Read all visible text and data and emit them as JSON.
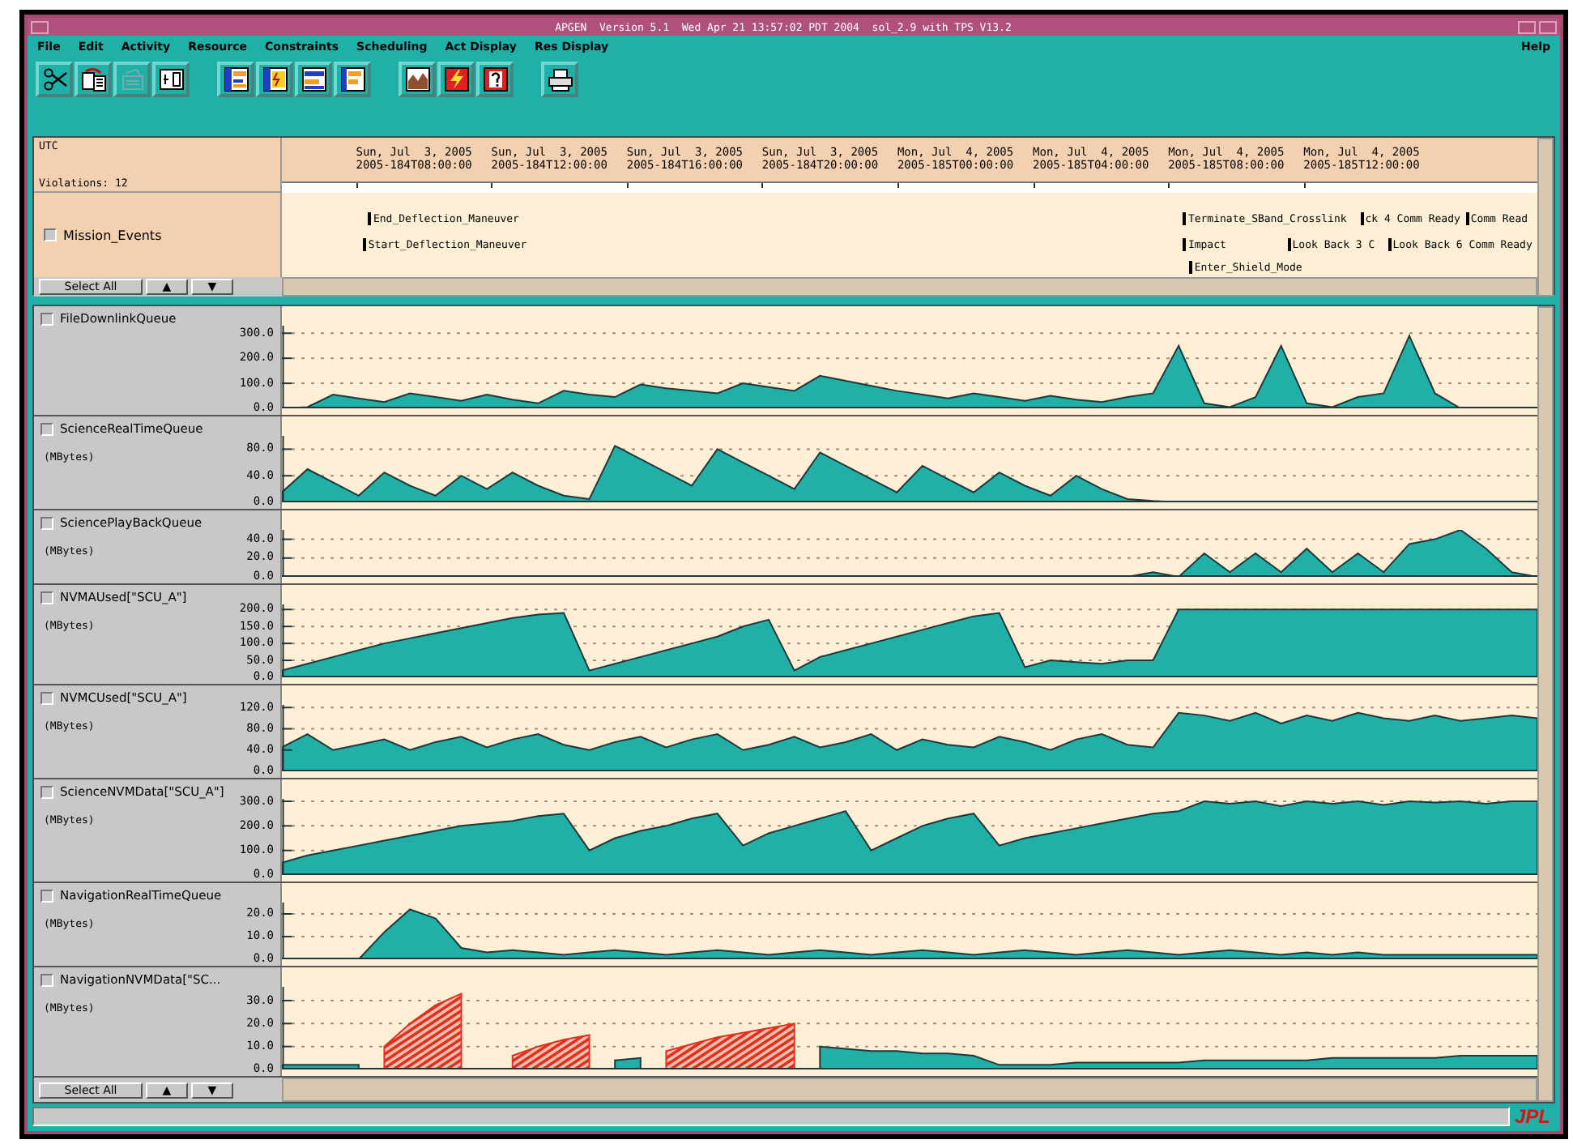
{
  "window": {
    "title": "APGEN  Version 5.1  Wed Apr 21 13:57:02 PDT 2004  sol_2.9 with TPS V13.2"
  },
  "menu": {
    "items": [
      "File",
      "Edit",
      "Activity",
      "Resource",
      "Constraints",
      "Scheduling",
      "Act Display",
      "Res Display"
    ],
    "help": "Help"
  },
  "timeline": {
    "zone": "UTC",
    "violations": "Violations: 12",
    "ticks": [
      {
        "date": "Sun, Jul  3, 2005",
        "stamp": "2005-184T08:00:00"
      },
      {
        "date": "Sun, Jul  3, 2005",
        "stamp": "2005-184T12:00:00"
      },
      {
        "date": "Sun, Jul  3, 2005",
        "stamp": "2005-184T16:00:00"
      },
      {
        "date": "Sun, Jul  3, 2005",
        "stamp": "2005-184T20:00:00"
      },
      {
        "date": "Mon, Jul  4, 2005",
        "stamp": "2005-185T00:00:00"
      },
      {
        "date": "Mon, Jul  4, 2005",
        "stamp": "2005-185T04:00:00"
      },
      {
        "date": "Mon, Jul  4, 2005",
        "stamp": "2005-185T08:00:00"
      },
      {
        "date": "Mon, Jul  4, 2005",
        "stamp": "2005-185T12:00:00"
      }
    ]
  },
  "activity_panel": {
    "legend": {
      "label": "Mission_Events",
      "checked": false
    },
    "lanes": [
      [
        "End_Deflection_Maneuver",
        "Terminate_SBand_Crosslink",
        "ck 4 Comm Ready",
        "Comm Read"
      ],
      [
        "Start_Deflection_Maneuver",
        "Impact",
        "Look Back 3 C",
        "Look Back 6 Comm Ready"
      ],
      [
        "Enter_Shield_Mode"
      ]
    ],
    "buttons": [
      "Select All",
      "▲",
      "▼"
    ]
  },
  "resources": [
    {
      "name": "FileDownlinkQueue",
      "checked": false,
      "chart_data": {
        "type": "area",
        "grid": true,
        "ylim": [
          0,
          330
        ],
        "yticks": [
          {
            "value": 0,
            "label": "0.0"
          },
          {
            "value": 100,
            "label": "100.0"
          },
          {
            "value": 200,
            "label": "200.0"
          },
          {
            "value": 300,
            "label": "300.0"
          }
        ],
        "series": [
          {
            "color": "#20b0a8",
            "values": [
              0,
              5,
              55,
              40,
              25,
              60,
              45,
              30,
              55,
              35,
              20,
              70,
              55,
              45,
              95,
              80,
              70,
              60,
              100,
              85,
              70,
              130,
              110,
              90,
              70,
              55,
              40,
              60,
              45,
              30,
              50,
              35,
              25,
              45,
              60,
              250,
              20,
              5,
              45,
              250,
              20,
              5,
              45,
              60,
              290,
              60,
              0,
              0,
              0,
              0
            ]
          }
        ]
      }
    },
    {
      "name": "ScienceRealTimeQueue",
      "unit": "(MBytes)",
      "checked": false,
      "chart_data": {
        "type": "area",
        "grid": true,
        "ylim": [
          0,
          100
        ],
        "yticks": [
          {
            "value": 0,
            "label": "0.0"
          },
          {
            "value": 40,
            "label": "40.0"
          },
          {
            "value": 80,
            "label": "80.0"
          }
        ],
        "series": [
          {
            "color": "#20b0a8",
            "values": [
              15,
              50,
              30,
              10,
              45,
              25,
              10,
              40,
              20,
              45,
              25,
              10,
              5,
              85,
              65,
              45,
              25,
              80,
              60,
              40,
              20,
              75,
              55,
              35,
              15,
              55,
              35,
              15,
              45,
              25,
              10,
              40,
              20,
              5,
              2,
              0,
              0,
              0,
              0,
              0,
              0,
              0,
              0,
              0,
              0,
              0,
              0,
              0,
              0,
              0
            ]
          }
        ]
      }
    },
    {
      "name": "SciencePlayBackQueue",
      "unit": "(MBytes)",
      "checked": false,
      "chart_data": {
        "type": "area",
        "grid": true,
        "ylim": [
          0,
          50
        ],
        "yticks": [
          {
            "value": 0,
            "label": "0.0"
          },
          {
            "value": 20,
            "label": "20.0"
          },
          {
            "value": 40,
            "label": "40.0"
          }
        ],
        "series": [
          {
            "color": "#20b0a8",
            "values": [
              0,
              0,
              0,
              0,
              0,
              0,
              0,
              0,
              0,
              0,
              0,
              0,
              0,
              0,
              0,
              0,
              0,
              0,
              0,
              0,
              0,
              0,
              0,
              0,
              0,
              0,
              0,
              0,
              0,
              0,
              0,
              0,
              0,
              0,
              5,
              0,
              25,
              5,
              25,
              5,
              30,
              5,
              25,
              5,
              35,
              40,
              50,
              30,
              5,
              0
            ]
          }
        ]
      }
    },
    {
      "name": "NVMAUsed[\"SCU_A\"]",
      "unit": "(MBytes)",
      "checked": false,
      "chart_data": {
        "type": "area",
        "grid": true,
        "ylim": [
          0,
          215
        ],
        "yticks": [
          {
            "value": 0,
            "label": "0.0"
          },
          {
            "value": 50,
            "label": "50.0"
          },
          {
            "value": 100,
            "label": "100.0"
          },
          {
            "value": 150,
            "label": "150.0"
          },
          {
            "value": 200,
            "label": "200.0"
          }
        ],
        "series": [
          {
            "color": "#20b0a8",
            "values": [
              20,
              40,
              60,
              80,
              100,
              115,
              130,
              145,
              160,
              175,
              185,
              190,
              20,
              40,
              60,
              80,
              100,
              120,
              150,
              170,
              20,
              60,
              80,
              100,
              120,
              140,
              160,
              180,
              190,
              30,
              50,
              45,
              40,
              50,
              50,
              200,
              200,
              200,
              200,
              200,
              200,
              200,
              200,
              200,
              200,
              200,
              200,
              200,
              200,
              200
            ]
          }
        ]
      }
    },
    {
      "name": "NVMCUsed[\"SCU_A\"]",
      "unit": "(MBytes)",
      "checked": false,
      "chart_data": {
        "type": "area",
        "grid": true,
        "ylim": [
          0,
          125
        ],
        "yticks": [
          {
            "value": 0,
            "label": "0.0"
          },
          {
            "value": 40,
            "label": "40.0"
          },
          {
            "value": 80,
            "label": "80.0"
          },
          {
            "value": 120,
            "label": "120.0"
          }
        ],
        "series": [
          {
            "color": "#20b0a8",
            "values": [
              45,
              70,
              40,
              50,
              60,
              40,
              55,
              65,
              45,
              60,
              70,
              50,
              40,
              55,
              65,
              45,
              60,
              70,
              40,
              50,
              65,
              45,
              55,
              70,
              40,
              60,
              50,
              45,
              65,
              55,
              40,
              60,
              70,
              50,
              45,
              110,
              105,
              95,
              110,
              90,
              105,
              95,
              110,
              100,
              95,
              105,
              95,
              100,
              105,
              100
            ]
          }
        ]
      }
    },
    {
      "name": "ScienceNVMData[\"SCU_A\"]",
      "unit": "(MBytes)",
      "checked": false,
      "chart_data": {
        "type": "area",
        "grid": true,
        "ylim": [
          0,
          310
        ],
        "yticks": [
          {
            "value": 0,
            "label": "0.0"
          },
          {
            "value": 100,
            "label": "100.0"
          },
          {
            "value": 200,
            "label": "200.0"
          },
          {
            "value": 300,
            "label": "300.0"
          }
        ],
        "series": [
          {
            "color": "#20b0a8",
            "values": [
              50,
              80,
              100,
              120,
              140,
              160,
              180,
              200,
              210,
              220,
              240,
              250,
              100,
              150,
              180,
              200,
              230,
              250,
              120,
              170,
              200,
              230,
              260,
              100,
              150,
              200,
              230,
              250,
              120,
              150,
              170,
              190,
              210,
              230,
              250,
              260,
              300,
              290,
              300,
              280,
              300,
              290,
              300,
              285,
              300,
              295,
              300,
              290,
              300,
              300
            ]
          }
        ]
      }
    },
    {
      "name": "NavigationRealTimeQueue",
      "unit": "(MBytes)",
      "checked": false,
      "chart_data": {
        "type": "area",
        "grid": true,
        "ylim": [
          0,
          25
        ],
        "yticks": [
          {
            "value": 0,
            "label": "0.0"
          },
          {
            "value": 10,
            "label": "10.0"
          },
          {
            "value": 20,
            "label": "20.0"
          }
        ],
        "series": [
          {
            "color": "#20b0a8",
            "values": [
              0,
              0,
              0,
              0,
              12,
              22,
              18,
              5,
              3,
              4,
              3,
              2,
              3,
              4,
              3,
              2,
              3,
              4,
              3,
              2,
              3,
              4,
              3,
              2,
              3,
              4,
              3,
              2,
              3,
              4,
              3,
              2,
              3,
              4,
              3,
              2,
              3,
              4,
              3,
              2,
              3,
              2,
              3,
              2,
              2,
              2,
              2,
              2,
              2,
              2
            ]
          }
        ]
      }
    },
    {
      "name": "NavigationNVMData[\"SC...",
      "unit": "(MBytes)",
      "checked": false,
      "chart_data": {
        "type": "area",
        "grid": true,
        "ylim": [
          0,
          36
        ],
        "yticks": [
          {
            "value": 0,
            "label": "0.0"
          },
          {
            "value": 10,
            "label": "10.0"
          },
          {
            "value": 20,
            "label": "20.0"
          },
          {
            "value": 30,
            "label": "30.0"
          }
        ],
        "series": [
          {
            "color": "#20b0a8",
            "values": [
              2,
              2,
              2,
              2,
              null,
              null,
              null,
              null,
              null,
              null,
              null,
              null,
              null,
              4,
              5,
              null,
              null,
              null,
              null,
              null,
              null,
              10,
              9,
              8,
              8,
              7,
              7,
              6,
              2,
              2,
              2,
              3,
              3,
              3,
              3,
              3,
              4,
              4,
              4,
              4,
              4,
              5,
              5,
              5,
              5,
              5,
              6,
              6,
              6,
              6
            ]
          },
          {
            "color": "#e03020",
            "values": [
              null,
              null,
              null,
              null,
              10,
              20,
              28,
              33,
              null,
              6,
              10,
              13,
              15,
              null,
              null,
              8,
              11,
              14,
              16,
              18,
              20,
              null,
              null,
              null,
              null,
              null,
              null,
              null,
              null,
              null,
              null,
              null,
              null,
              null,
              null,
              null,
              null,
              null,
              null,
              null,
              null,
              null,
              null,
              null,
              null,
              null,
              null,
              null,
              null,
              null
            ]
          }
        ]
      }
    }
  ],
  "resource_buttons": [
    "Select All",
    "▲",
    "▼"
  ],
  "logo": "JPL"
}
